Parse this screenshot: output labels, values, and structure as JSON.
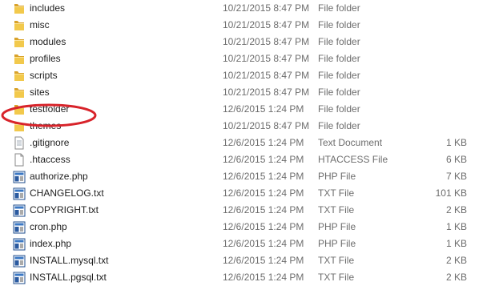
{
  "files": [
    {
      "name": "includes",
      "date": "10/21/2015 8:47 PM",
      "type": "File folder",
      "size": "",
      "icon": "folder-icon"
    },
    {
      "name": "misc",
      "date": "10/21/2015 8:47 PM",
      "type": "File folder",
      "size": "",
      "icon": "folder-icon"
    },
    {
      "name": "modules",
      "date": "10/21/2015 8:47 PM",
      "type": "File folder",
      "size": "",
      "icon": "folder-icon"
    },
    {
      "name": "profiles",
      "date": "10/21/2015 8:47 PM",
      "type": "File folder",
      "size": "",
      "icon": "folder-icon"
    },
    {
      "name": "scripts",
      "date": "10/21/2015 8:47 PM",
      "type": "File folder",
      "size": "",
      "icon": "folder-icon"
    },
    {
      "name": "sites",
      "date": "10/21/2015 8:47 PM",
      "type": "File folder",
      "size": "",
      "icon": "folder-icon"
    },
    {
      "name": "testfolder",
      "date": "12/6/2015 1:24 PM",
      "type": "File folder",
      "size": "",
      "icon": "folder-icon"
    },
    {
      "name": "themes",
      "date": "10/21/2015 8:47 PM",
      "type": "File folder",
      "size": "",
      "icon": "folder-icon"
    },
    {
      "name": ".gitignore",
      "date": "12/6/2015 1:24 PM",
      "type": "Text Document",
      "size": "1 KB",
      "icon": "text-file-icon"
    },
    {
      "name": ".htaccess",
      "date": "12/6/2015 1:24 PM",
      "type": "HTACCESS File",
      "size": "6 KB",
      "icon": "blank-file-icon"
    },
    {
      "name": "authorize.php",
      "date": "12/6/2015 1:24 PM",
      "type": "PHP File",
      "size": "7 KB",
      "icon": "code-file-icon"
    },
    {
      "name": "CHANGELOG.txt",
      "date": "12/6/2015 1:24 PM",
      "type": "TXT File",
      "size": "101 KB",
      "icon": "code-file-icon"
    },
    {
      "name": "COPYRIGHT.txt",
      "date": "12/6/2015 1:24 PM",
      "type": "TXT File",
      "size": "2 KB",
      "icon": "code-file-icon"
    },
    {
      "name": "cron.php",
      "date": "12/6/2015 1:24 PM",
      "type": "PHP File",
      "size": "1 KB",
      "icon": "code-file-icon"
    },
    {
      "name": "index.php",
      "date": "12/6/2015 1:24 PM",
      "type": "PHP File",
      "size": "1 KB",
      "icon": "code-file-icon"
    },
    {
      "name": "INSTALL.mysql.txt",
      "date": "12/6/2015 1:24 PM",
      "type": "TXT File",
      "size": "2 KB",
      "icon": "code-file-icon"
    },
    {
      "name": "INSTALL.pgsql.txt",
      "date": "12/6/2015 1:24 PM",
      "type": "TXT File",
      "size": "2 KB",
      "icon": "code-file-icon"
    }
  ],
  "colors": {
    "folder": "#e8b83a",
    "annotation": "#d8232a",
    "secondary_text": "#6d6d6d"
  }
}
